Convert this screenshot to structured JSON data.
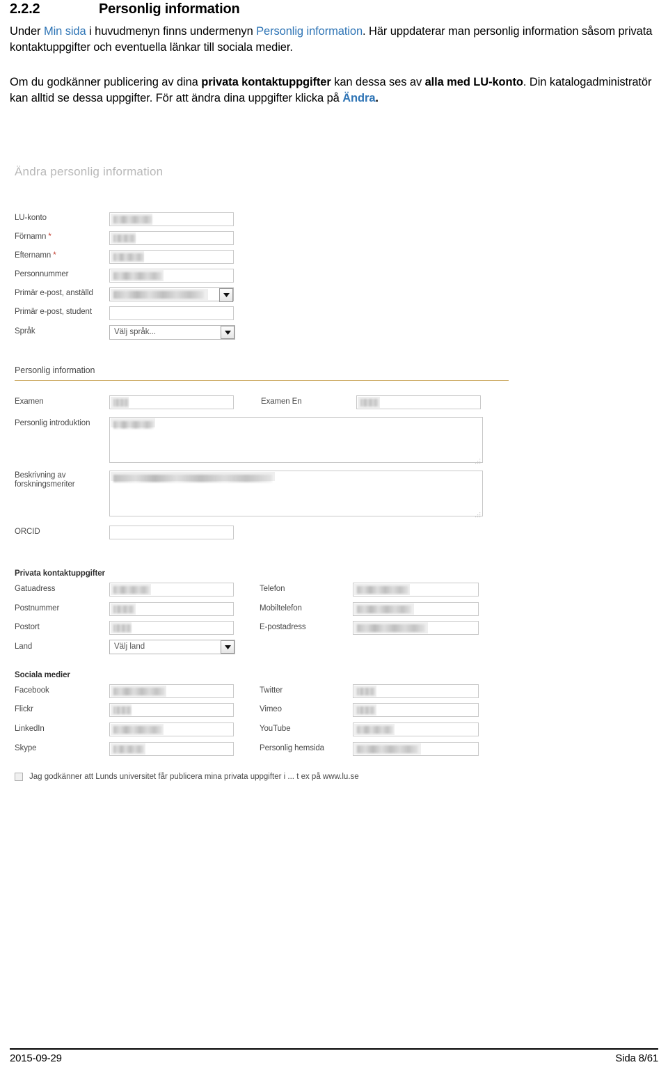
{
  "document": {
    "heading": {
      "number": "2.2.2",
      "title": "Personlig information"
    },
    "paragraph1": {
      "t1": "Under ",
      "link1": "Min sida",
      "t2": " i huvudmenyn finns undermenyn ",
      "link2": "Personlig information",
      "t3": ". Här uppdaterar man personlig information såsom privata kontaktuppgifter och eventuella länkar till sociala medier."
    },
    "paragraph2": {
      "t1": "Om du godkänner publicering av dina ",
      "b1": "privata kontaktuppgifter",
      "t2": " kan dessa ses av ",
      "b2": "alla med LU-konto",
      "t3": ". Din katalogadministratör kan alltid se dessa uppgifter. För att ändra dina uppgifter klicka på ",
      "link1": "Ändra",
      "t4": "."
    }
  },
  "screenshot": {
    "title": "Ändra personlig information",
    "account_fields": [
      {
        "label": "LU-konto",
        "required": false,
        "type": "text",
        "value": "",
        "filled": true,
        "fill_width": 56
      },
      {
        "label": "Förnamn ",
        "required": true,
        "type": "text",
        "value": "",
        "filled": true,
        "fill_width": 32
      },
      {
        "label": "Efternamn ",
        "required": true,
        "type": "text",
        "value": "",
        "filled": true,
        "fill_width": 44
      },
      {
        "label": "Personnummer",
        "required": false,
        "type": "text",
        "value": "",
        "filled": true,
        "fill_width": 70
      },
      {
        "label": "Primär e-post, anställd",
        "required": false,
        "type": "select",
        "value": "",
        "filled": true,
        "fill_width": 130
      },
      {
        "label": "Primär e-post, student",
        "required": false,
        "type": "text",
        "value": "",
        "filled": false,
        "fill_width": 0
      },
      {
        "label": "Språk",
        "required": false,
        "type": "select",
        "value": "Välj språk...",
        "filled": false,
        "fill_width": 0
      }
    ],
    "section_personal": {
      "heading": "Personlig information",
      "examen_label": "Examen",
      "examen_value_width": 22,
      "examen_en_label": "Examen En",
      "examen_en_value_width": 26,
      "intro_label": "Personlig introduktion",
      "intro_value_width": 58,
      "research_label_line1": "Beskrivning av",
      "research_label_line2": "forskningsmeriter",
      "research_value_width": 228,
      "orcid_label": "ORCID"
    },
    "section_contact": {
      "heading": "Privata kontaktuppgifter",
      "left": [
        {
          "label": "Gatuadress",
          "type": "text",
          "value": "",
          "fill_width": 52
        },
        {
          "label": "Postnummer",
          "type": "text",
          "value": "",
          "fill_width": 30
        },
        {
          "label": "Postort",
          "type": "text",
          "value": "",
          "fill_width": 26
        },
        {
          "label": "Land",
          "type": "select",
          "value": "Välj land",
          "fill_width": 0
        }
      ],
      "right": [
        {
          "label": "Telefon",
          "type": "text",
          "value": "",
          "fill_width": 74
        },
        {
          "label": "Mobiltelefon",
          "type": "text",
          "value": "",
          "fill_width": 78
        },
        {
          "label": "E-postadress",
          "type": "text",
          "value": "",
          "fill_width": 98
        }
      ]
    },
    "section_social": {
      "heading": "Sociala medier",
      "left": [
        {
          "label": "Facebook",
          "fill_width": 74
        },
        {
          "label": "Flickr",
          "fill_width": 26
        },
        {
          "label": "LinkedIn",
          "fill_width": 70
        },
        {
          "label": "Skype",
          "fill_width": 44
        }
      ],
      "right": [
        {
          "label": "Twitter",
          "fill_width": 26
        },
        {
          "label": "Vimeo",
          "fill_width": 26
        },
        {
          "label": "YouTube",
          "fill_width": 52
        },
        {
          "label": "Personlig hemsida",
          "fill_width": 88
        }
      ]
    },
    "consent": {
      "checked": false,
      "label": "Jag godkänner att Lunds universitet får publicera mina privata uppgifter i ... t ex på www.lu.se"
    }
  },
  "footer": {
    "date": "2015-09-29",
    "page": "Sida 8/61"
  },
  "colors": {
    "link": "#2E74B5",
    "section_rule": "#C8A456",
    "title_gray": "#B8B8B8",
    "required_star": "#C0392B"
  }
}
